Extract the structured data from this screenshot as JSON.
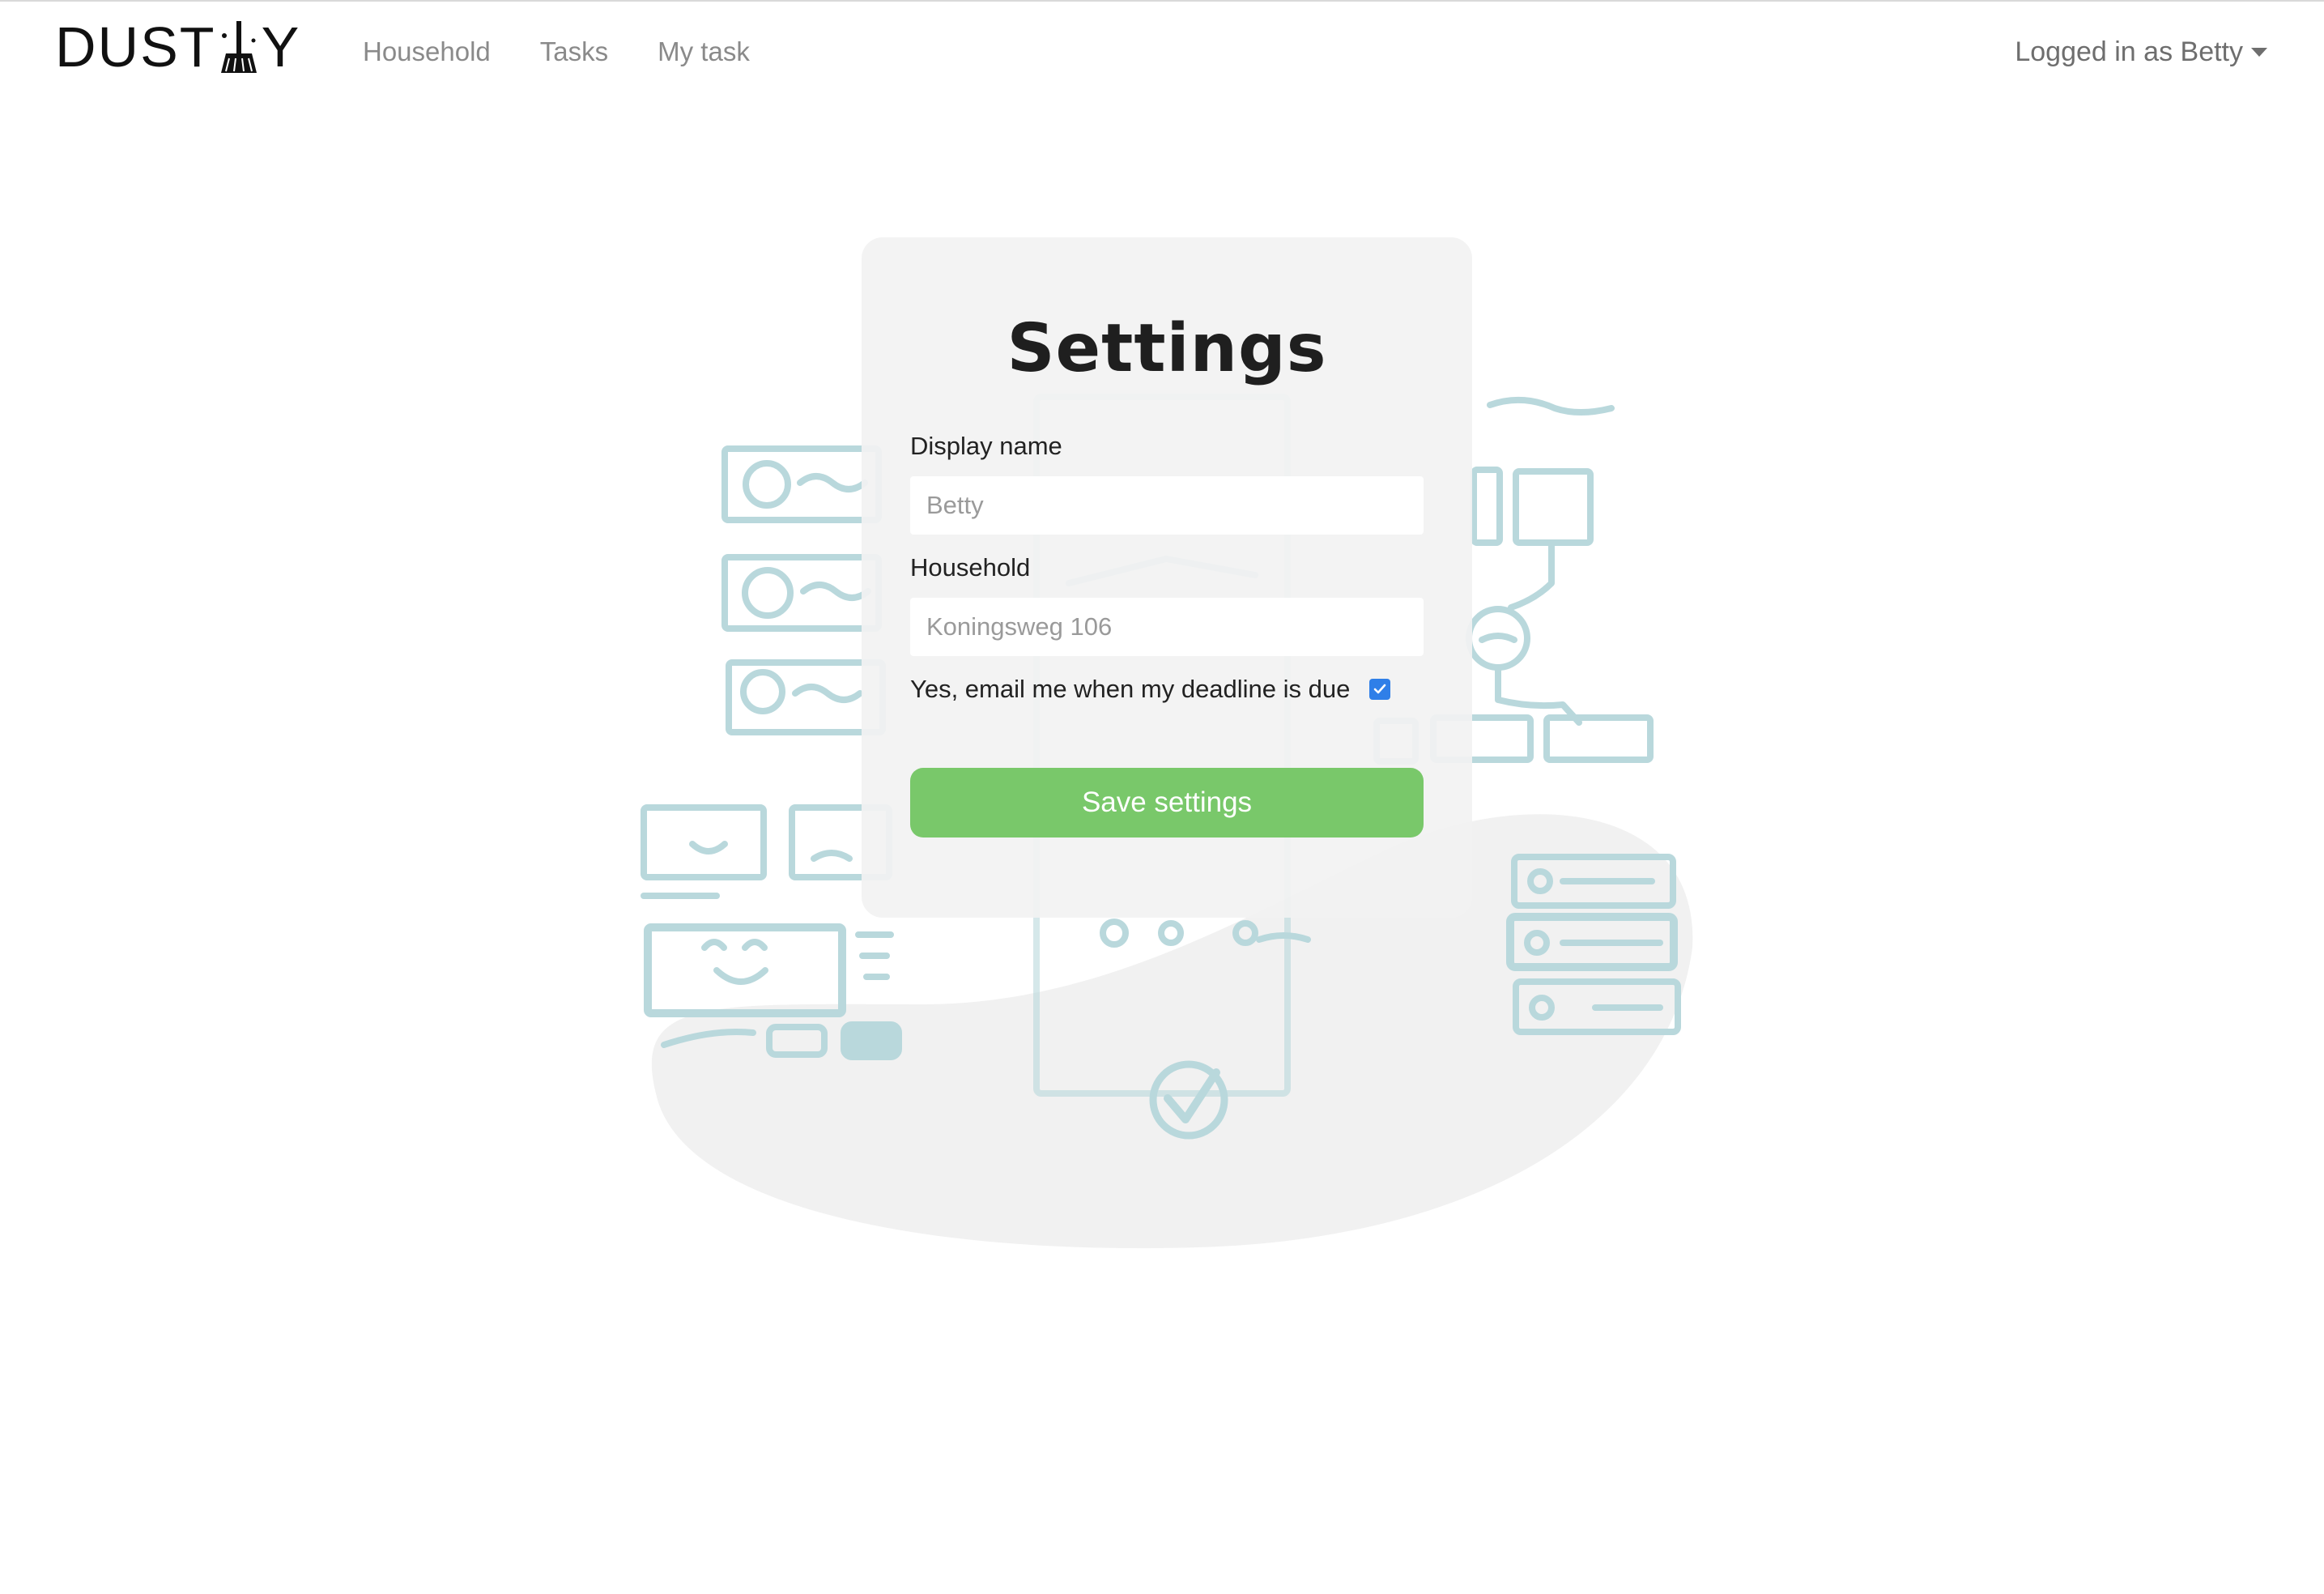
{
  "brand": {
    "logo_text_left": "DUST",
    "logo_text_right": "Y"
  },
  "nav": {
    "links": [
      "Household",
      "Tasks",
      "My task"
    ],
    "user_menu_label": "Logged in as Betty"
  },
  "settings": {
    "title": "Settings",
    "display_name_label": "Display name",
    "display_name_placeholder": "Betty",
    "household_label": "Household",
    "household_placeholder": "Koningsweg 106",
    "email_checkbox_label": "Yes, email me when my deadline is due",
    "email_checkbox_checked": true,
    "save_button_label": "Save settings"
  },
  "colors": {
    "accent_green": "#79c86a",
    "checkbox_blue": "#2f7fe8",
    "illustration_teal": "#b9d8dc",
    "blob_grey": "#f1f1f1"
  },
  "icons": [
    "broom-icon",
    "caret-down-icon",
    "checkmark-icon"
  ]
}
